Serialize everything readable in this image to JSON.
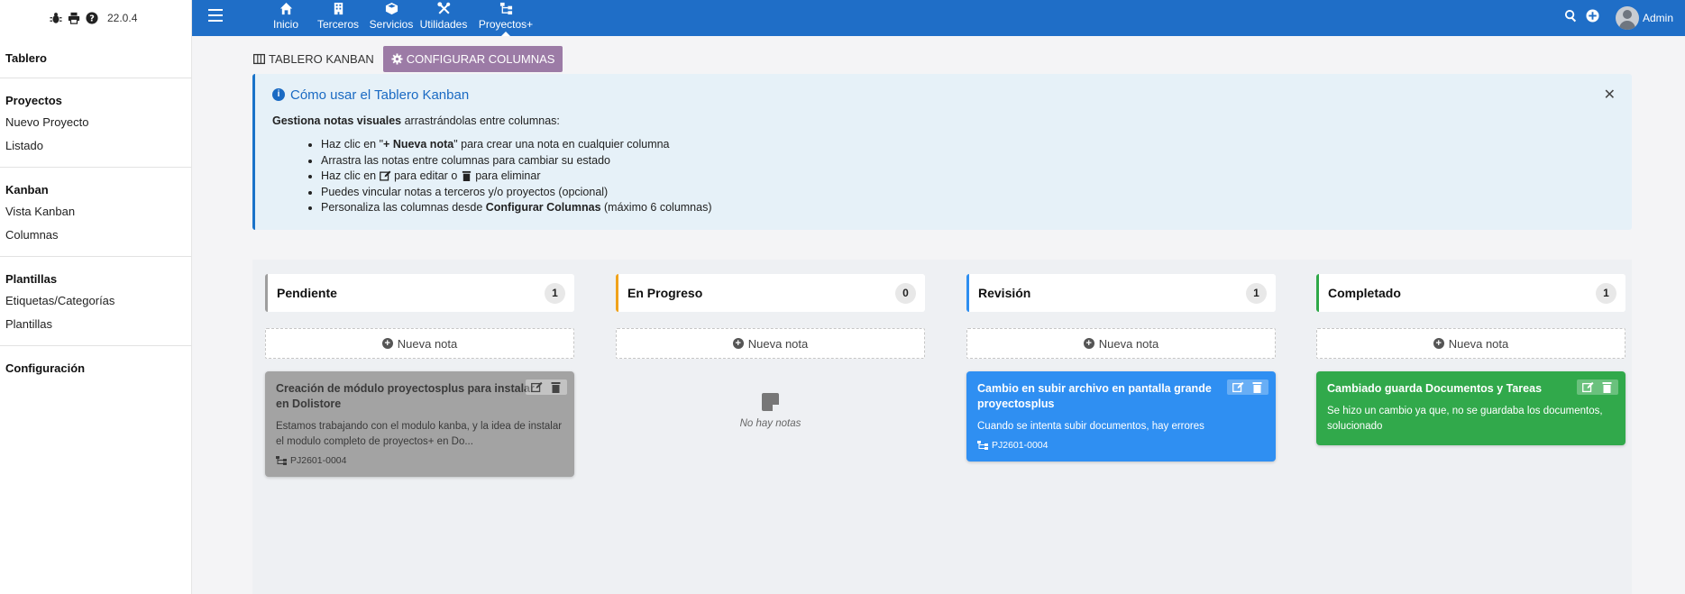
{
  "app": {
    "version": "22.0.4"
  },
  "sidebar": {
    "sections": [
      {
        "head": "Tablero",
        "items": []
      },
      {
        "head": "Proyectos",
        "items": [
          "Nuevo Proyecto",
          "Listado"
        ]
      },
      {
        "head": "Kanban",
        "items": [
          "Vista Kanban",
          "Columnas"
        ]
      },
      {
        "head": "Plantillas",
        "items": [
          "Etiquetas/Categorías",
          "Plantillas"
        ]
      },
      {
        "head": "Configuración",
        "items": []
      }
    ]
  },
  "topbar": {
    "nav": [
      "Inicio",
      "Terceros",
      "Servicios",
      "Utilidades",
      "Proyectos+"
    ],
    "user": "Admin"
  },
  "tabs": {
    "board": "TABLERO KANBAN",
    "config": "CONFIGURAR COLUMNAS"
  },
  "info": {
    "title": "Cómo usar el Tablero Kanban",
    "lead_bold": "Gestiona notas visuales",
    "lead_rest": " arrastrándolas entre columnas:",
    "li1_a": "Haz clic en \"",
    "li1_b": "+ Nueva nota",
    "li1_c": "\" para crear una nota en cualquier columna",
    "li2": "Arrastra las notas entre columnas para cambiar su estado",
    "li3_a": "Haz clic en ",
    "li3_b": " para editar o ",
    "li3_c": " para eliminar",
    "li4": "Puedes vincular notas a terceros y/o proyectos (opcional)",
    "li5_a": "Personaliza las columnas desde ",
    "li5_b": "Configurar Columnas",
    "li5_c": " (máximo 6 columnas)"
  },
  "board": {
    "new_note_label": "Nueva nota",
    "empty_label": "No hay notas",
    "columns": [
      {
        "title": "Pendiente",
        "count": "1",
        "accent": "#9e9e9e",
        "card": {
          "title": "Creación de módulo proyectosplus para instalar en Dolistore",
          "desc": "Estamos trabajando con el modulo kanba, y la idea de instalar el modulo completo de proyectos+ en Do...",
          "ref": "PJ2601-0004",
          "bg": "#a3a3a3",
          "fg": "#3a3a3a"
        }
      },
      {
        "title": "En Progreso",
        "count": "0",
        "accent": "#f0a21b",
        "card": null
      },
      {
        "title": "Revisión",
        "count": "1",
        "accent": "#2d8ef0",
        "card": {
          "title": "Cambio en subir archivo en pantalla grande proyectosplus",
          "desc": "Cuando se intenta subir documentos, hay errores",
          "ref": "PJ2601-0004",
          "bg": "#2f8ff2",
          "fg": "#ffffff"
        }
      },
      {
        "title": "Completado",
        "count": "1",
        "accent": "#2ea848",
        "card": {
          "title": "Cambiado guarda Documentos y Tareas",
          "desc": "Se hizo un cambio ya que, no se guardaba los documentos, solucionado",
          "ref": "",
          "bg": "#31a94b",
          "fg": "#ffffff"
        }
      }
    ]
  },
  "colors": {
    "topbar": "#1f6ec7",
    "accent_tab": "#9c7ba6",
    "info_title": "#1a6ac3"
  }
}
